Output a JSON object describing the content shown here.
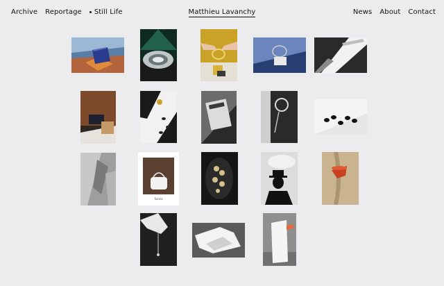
{
  "nav": {
    "archive": "Archive",
    "reportage": "Reportage",
    "still_life": "Still Life",
    "site_title": "Matthieu Lavanchy",
    "news": "News",
    "about": "About",
    "contact": "Contact"
  },
  "gallery": {
    "poster_caption": "Salvia"
  }
}
